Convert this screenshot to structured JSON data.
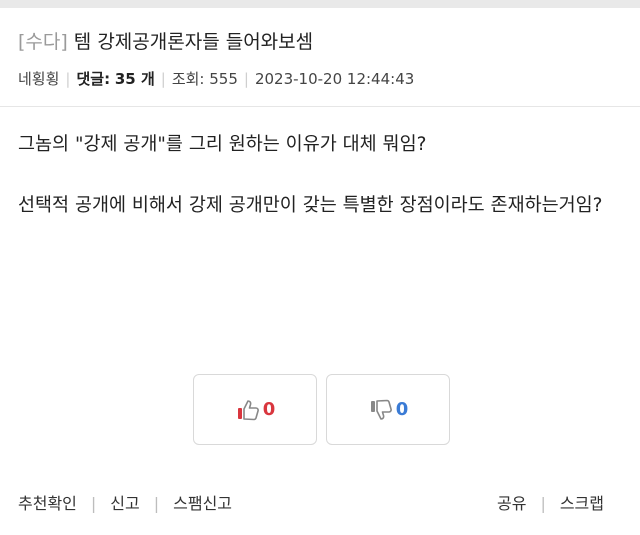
{
  "post": {
    "category": "[수다]",
    "title": "템 강제공개론자들 들어와보셈",
    "author": "네횡횡",
    "comments_label": "댓글:",
    "comments_count": "35 개",
    "views_label": "조회:",
    "views": "555",
    "datetime": "2023-10-20 12:44:43",
    "paragraphs": [
      "그놈의 \"강제 공개\"를 그리 원하는 이유가 대체 뭐임?",
      "선택적 공개에 비해서 강제 공개만이 갖는 특별한 장점이라도 존재하는거임?"
    ]
  },
  "votes": {
    "up_count": "0",
    "down_count": "0",
    "up_icon": "thumbs-up-icon",
    "down_icon": "thumbs-down-icon",
    "up_color": "#d9363e",
    "down_color": "#3a7bd5"
  },
  "footer": {
    "recommend_check": "추천확인",
    "report": "신고",
    "spam_report": "스팸신고",
    "share": "공유",
    "scrap": "스크랩"
  }
}
